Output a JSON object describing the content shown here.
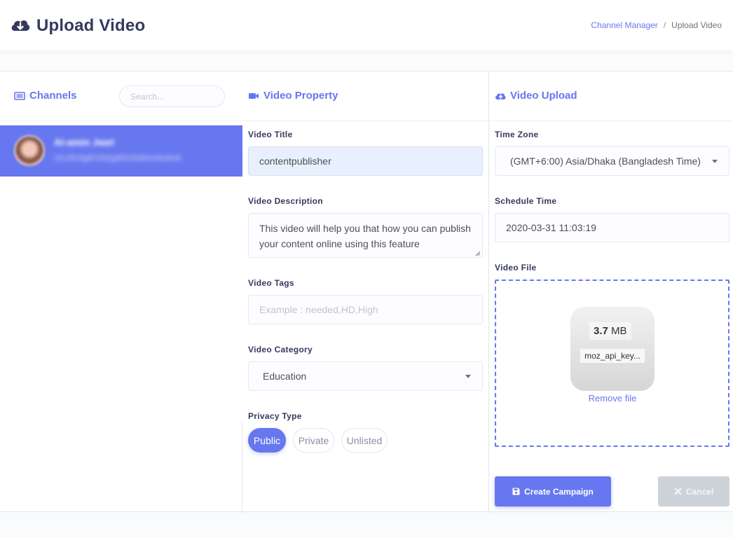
{
  "header": {
    "title": "Upload Video",
    "breadcrumb": [
      "Channel Manager",
      "/",
      "Upload Video"
    ]
  },
  "channels": {
    "title": "Channels",
    "search_placeholder": "Search...",
    "items": [
      {
        "name": "Al-amin Jwel",
        "id": "UCxRr8gRVSGgW5OKBmnNx8n8"
      }
    ]
  },
  "video_property": {
    "title": "Video Property",
    "title_label": "Video Title",
    "title_value": "contentpublisher",
    "description_label": "Video Description",
    "description_value": "This video will help you that how you can publish your content online using this feature",
    "tags_label": "Video Tags",
    "tags_placeholder": "Example : needed,HD,High",
    "category_label": "Video Category",
    "category_value": "Education",
    "privacy_label": "Privacy Type",
    "privacy_options": [
      "Public",
      "Private",
      "Unlisted"
    ],
    "privacy_selected": "Public"
  },
  "video_upload": {
    "title": "Video Upload",
    "timezone_label": "Time Zone",
    "timezone_value": "(GMT+6:00) Asia/Dhaka (Bangladesh Time)",
    "schedule_label": "Schedule Time",
    "schedule_value": "2020-03-31 11:03:19",
    "file_label": "Video File",
    "file_size_number": "3.7",
    "file_size_unit": "MB",
    "file_name": "moz_api_key...",
    "remove_label": "Remove file"
  },
  "actions": {
    "create_label": "Create Campaign",
    "cancel_label": "Cancel"
  },
  "colors": {
    "accent": "#6777ef",
    "text": "#34395e",
    "cancel": "#cdd3d8"
  }
}
